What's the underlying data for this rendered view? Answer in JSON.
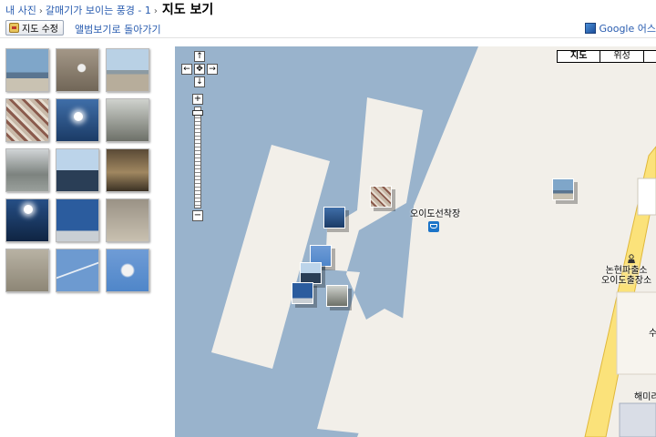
{
  "breadcrumb": {
    "items": [
      "내 사진",
      "갈매기가 보이는 풍경 - 1"
    ],
    "current": "지도 보기",
    "separator": "›"
  },
  "toolbar": {
    "edit_map_label": "지도 수정",
    "back_to_album_label": "앨범보기로 돌아가기",
    "google_earth_label": "Google 어스"
  },
  "thumbnails": [
    {
      "name": "gull-sky"
    },
    {
      "name": "gull-on-beach"
    },
    {
      "name": "beach-flat"
    },
    {
      "name": "gull-flock"
    },
    {
      "name": "sun-over-sea"
    },
    {
      "name": "birds-on-water"
    },
    {
      "name": "gulls-mudflat"
    },
    {
      "name": "people-silhouette"
    },
    {
      "name": "sepia-shore"
    },
    {
      "name": "sun-glare-sea"
    },
    {
      "name": "blue-sky-shore"
    },
    {
      "name": "sand-birds"
    },
    {
      "name": "gulls-on-sand"
    },
    {
      "name": "contrail-sky"
    },
    {
      "name": "gull-in-flight"
    }
  ],
  "map": {
    "type_buttons": [
      "지도",
      "위성"
    ],
    "pan_arrows": [
      "↑",
      "←",
      "✥",
      "→",
      "↓"
    ],
    "zoom_in": "+",
    "zoom_out": "−",
    "labels": {
      "ferry_terminal": "오이도선착장",
      "police_line1": "논현파출소",
      "police_line2": "오이도출장소",
      "partial_right": "수",
      "partial_bottom": "해미리"
    },
    "colors": {
      "water": "#99b3cc",
      "land": "#f2efe9",
      "road": "#fbe27a",
      "road_edge": "#e0b83a"
    }
  }
}
